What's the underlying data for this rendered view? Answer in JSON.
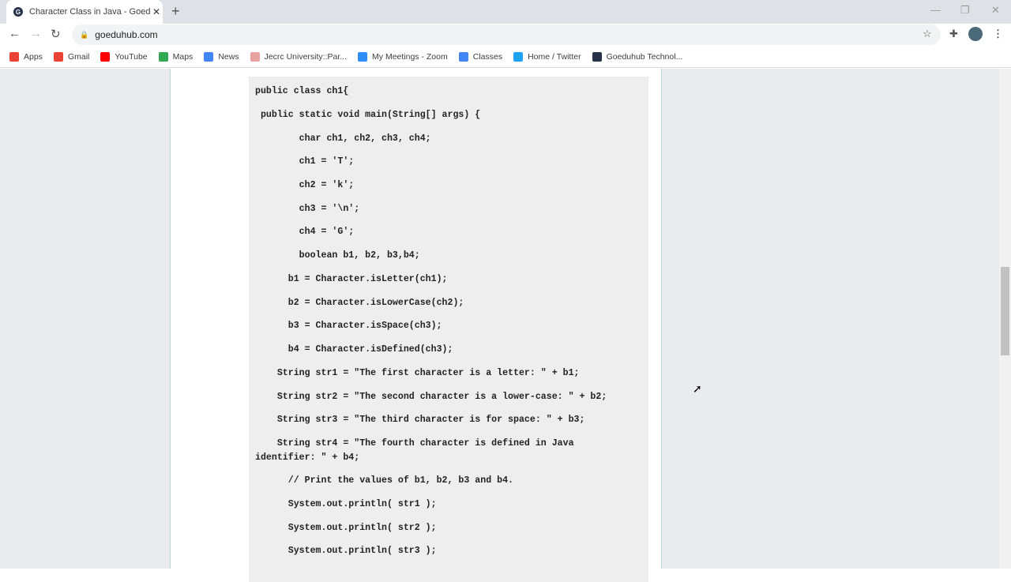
{
  "browser": {
    "tab_title": "Character Class in Java - Goeduhub",
    "tab_icon": "G",
    "url": "goeduhub.com",
    "bookmarks": [
      {
        "label": "Apps",
        "color": "#ea4335"
      },
      {
        "label": "Gmail",
        "color": "#ea4335"
      },
      {
        "label": "YouTube",
        "color": "#ff0000"
      },
      {
        "label": "Maps",
        "color": "#34a853"
      },
      {
        "label": "News",
        "color": "#4285f4"
      },
      {
        "label": "Jecrc University::Par...",
        "color": "#e8a0a0"
      },
      {
        "label": "My Meetings - Zoom",
        "color": "#2d8cff"
      },
      {
        "label": "Classes",
        "color": "#4285f4"
      },
      {
        "label": "Home / Twitter",
        "color": "#1da1f2"
      },
      {
        "label": "Goeduhub Technol...",
        "color": "#26324a"
      }
    ]
  },
  "code_lines": [
    "public class ch1{",
    " public static void main(String[] args) {",
    "        char ch1, ch2, ch3, ch4;",
    "        ch1 = 'T';",
    "        ch2 = 'k';",
    "        ch3 = '\\n';",
    "        ch4 = 'G';",
    "        boolean b1, b2, b3,b4;",
    "      b1 = Character.isLetter(ch1);",
    "      b2 = Character.isLowerCase(ch2);",
    "      b3 = Character.isSpace(ch3);",
    "      b4 = Character.isDefined(ch3);",
    "    String str1 = \"The first character is a letter: \" + b1;",
    "    String str2 = \"The second character is a lower-case: \" + b2;",
    "    String str3 = \"The third character is for space: \" + b3;",
    "    String str4 = \"The fourth character is defined in Java",
    "identifier: \" + b4;",
    "      // Print the values of b1, b2, b3 and b4.",
    "      System.out.println( str1 );",
    "      System.out.println( str2 );",
    "      System.out.println( str3 );"
  ]
}
